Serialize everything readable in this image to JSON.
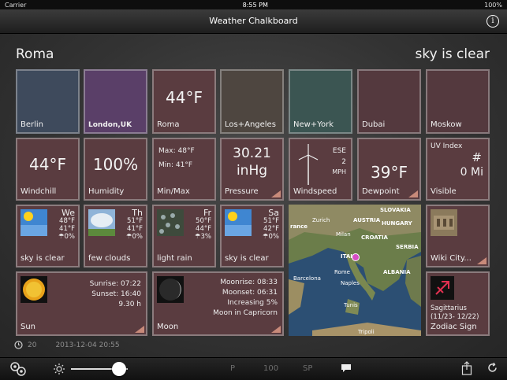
{
  "status": {
    "carrier": "Carrier",
    "time": "8:55 PM",
    "battery": "100%"
  },
  "nav": {
    "title": "Weather Chalkboard",
    "info_icon": "info-icon"
  },
  "header": {
    "city": "Roma",
    "condition": "sky is clear"
  },
  "cities": [
    {
      "name": "Berlin",
      "color": "#3e4a5c"
    },
    {
      "name": "London,UK",
      "color": "#5a3f68"
    },
    {
      "name": "Roma",
      "color": "#5a3c40",
      "temp": "44°F"
    },
    {
      "name": "Los+Angeles",
      "color": "#4e4640"
    },
    {
      "name": "New+York",
      "color": "#3b5552"
    },
    {
      "name": "Dubai",
      "color": "#54393e"
    },
    {
      "name": "Moskow",
      "color": "#54393e"
    }
  ],
  "metrics": {
    "windchill": {
      "value": "44°F",
      "label": "Windchill"
    },
    "humidity": {
      "value": "100%",
      "label": "Humidity"
    },
    "minmax": {
      "max": "Max: 48°F",
      "min": "Min: 41°F",
      "label": "Min/Max"
    },
    "pressure": {
      "value": "30.21",
      "unit": "inHg",
      "label": "Pressure"
    },
    "windspeed": {
      "dir": "ESE",
      "speed": "2",
      "unit": "MPH",
      "label": "Windspeed"
    },
    "dewpoint": {
      "value": "39°F",
      "label": "Dewpoint"
    },
    "uv": {
      "title": "UV Index",
      "value": "#",
      "vis": "0 Mi",
      "label": "Visible"
    }
  },
  "forecast": [
    {
      "day": "We",
      "hi": "48°F",
      "lo": "41°F",
      "rain": "☂0%",
      "desc": "sky is clear",
      "icon": "sun-icon"
    },
    {
      "day": "Th",
      "hi": "51°F",
      "lo": "41°F",
      "rain": "☂0%",
      "desc": "few clouds",
      "icon": "clouds-icon"
    },
    {
      "day": "Fr",
      "hi": "50°F",
      "lo": "44°F",
      "rain": "☂3%",
      "desc": "light rain",
      "icon": "rain-icon"
    },
    {
      "day": "Sa",
      "hi": "51°F",
      "lo": "42°F",
      "rain": "☂0%",
      "desc": "sky is clear",
      "icon": "sun-icon"
    }
  ],
  "map": {
    "labels": [
      "SLOVAKIA",
      "AUSTRIA",
      "HUNGARY",
      "Zurich",
      "Milan",
      "CROATIA",
      "SERBIA",
      "rance",
      "ITALY",
      "Rome",
      "ALBANIA",
      "Barcelona",
      "Naples",
      "Tunis",
      "Tripoli"
    ]
  },
  "wiki": {
    "label": "Wiki City..."
  },
  "sun": {
    "sunrise": "Sunrise: 07:22",
    "sunset": "Sunset: 16:40",
    "length": "9.30 h",
    "label": "Sun"
  },
  "moon": {
    "moonrise": "Moonrise: 08:33",
    "moonset": "Moonset: 06:31",
    "phase": "Increasing   5%",
    "sign": "Moon in Capricorn",
    "label": "Moon"
  },
  "zodiac": {
    "name": "Sagittarius",
    "range": "(11/23- 12/22)",
    "label": "Zodiac Sign"
  },
  "footer": {
    "num": "20",
    "datetime": "2013-12-04  20:55"
  },
  "toolbar": {
    "p": "P",
    "hundred": "100",
    "sp": "SP",
    "slider_value": 0.85
  }
}
